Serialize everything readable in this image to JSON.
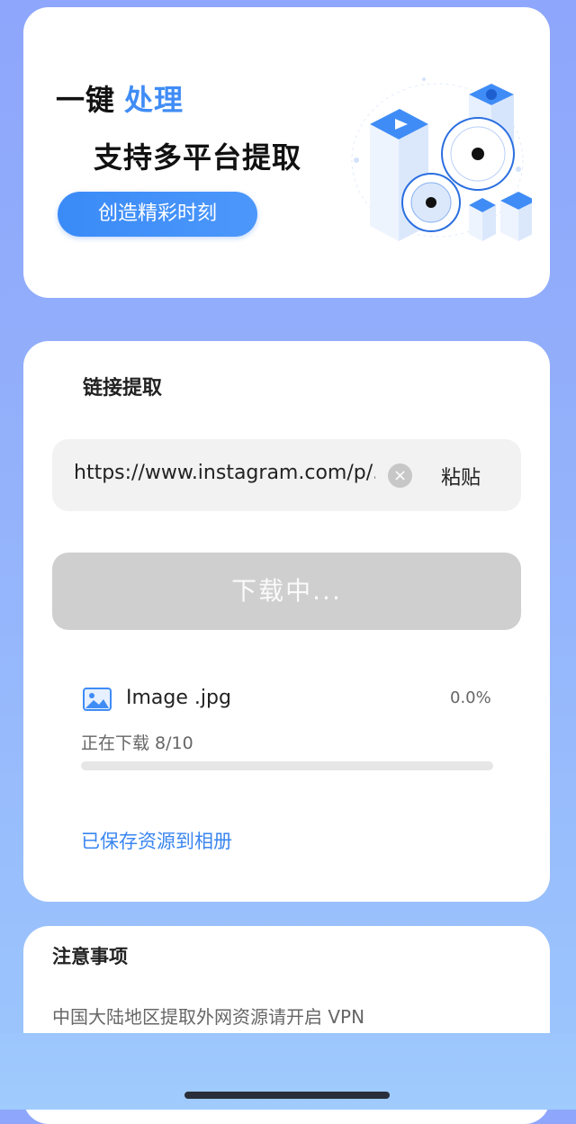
{
  "hero": {
    "title_part1": "一键",
    "title_part2": "处理",
    "subtitle": "支持多平台提取",
    "pill_label": "创造精彩时刻"
  },
  "extract": {
    "section_title": "链接提取",
    "url_value": "https://www.instagram.com/p/...",
    "paste_label": "粘贴",
    "download_label": "下载中...",
    "file": {
      "name": "Image .jpg",
      "percent_text": "0.0%",
      "progress_fraction": 0.0
    },
    "status_text": "正在下载 8/10",
    "saved_link": "已保存资源到相册"
  },
  "notes": {
    "title": "注意事项",
    "text": "中国大陆地区提取外网资源请开启 VPN"
  },
  "colors": {
    "accent": "#3f8cf6",
    "disabled_button": "#cfcfcf"
  },
  "icons": {
    "clear": "clear-icon",
    "image": "image-icon",
    "hero": "media-illustration"
  }
}
